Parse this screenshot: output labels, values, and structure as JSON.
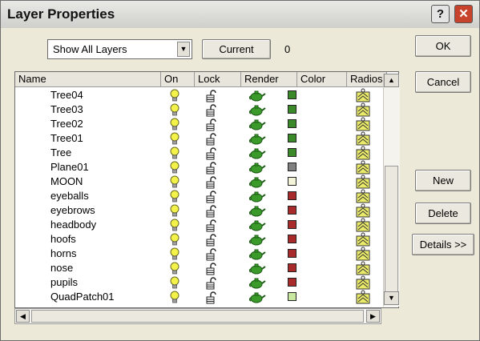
{
  "window": {
    "title": "Layer Properties",
    "help_label": "?",
    "close_label": "✕"
  },
  "toolbar": {
    "filter_value": "Show All Layers",
    "current_label": "Current",
    "current_value": "0"
  },
  "buttons": {
    "ok": "OK",
    "cancel": "Cancel",
    "new": "New",
    "delete": "Delete",
    "details": "Details >>"
  },
  "columns": [
    "Name",
    "On",
    "Lock",
    "Render",
    "Color",
    "Radios"
  ],
  "layers": [
    {
      "name": "Tree04",
      "color": "#3a8a2a"
    },
    {
      "name": "Tree03",
      "color": "#3a8a2a"
    },
    {
      "name": "Tree02",
      "color": "#3a8a2a"
    },
    {
      "name": "Tree01",
      "color": "#3a8a2a"
    },
    {
      "name": "Tree",
      "color": "#3a8a2a"
    },
    {
      "name": "Plane01",
      "color": "#808080"
    },
    {
      "name": "MOON",
      "color": "#f4f4d8"
    },
    {
      "name": "eyeballs",
      "color": "#a82a2a"
    },
    {
      "name": "eyebrows",
      "color": "#a82a2a"
    },
    {
      "name": "headbody",
      "color": "#a82a2a"
    },
    {
      "name": "hoofs",
      "color": "#a82a2a"
    },
    {
      "name": "horns",
      "color": "#a82a2a"
    },
    {
      "name": "nose",
      "color": "#a82a2a"
    },
    {
      "name": "pupils",
      "color": "#a82a2a"
    },
    {
      "name": "QuadPatch01",
      "color": "#c8e8a0"
    }
  ],
  "icons": {
    "on": "lightbulb-icon",
    "lock": "padlock-icon",
    "render": "teapot-icon",
    "radios": "radiosity-icon"
  }
}
